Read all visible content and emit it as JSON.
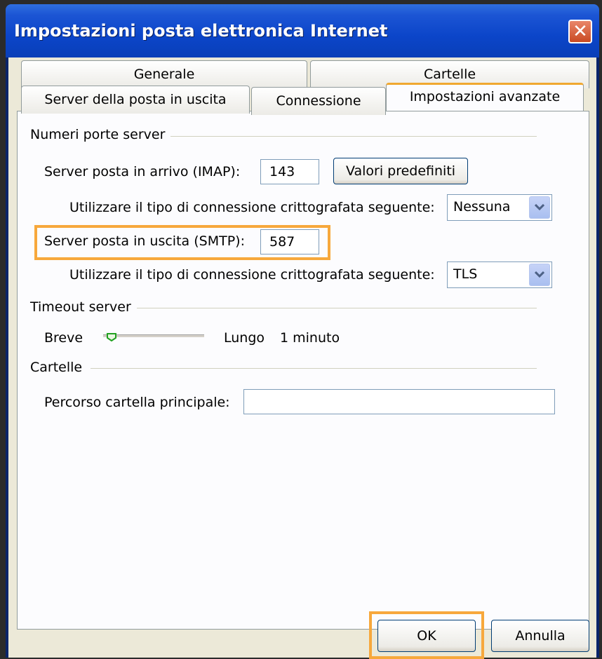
{
  "window": {
    "title": "Impostazioni posta elettronica Internet",
    "close_glyph": "✕"
  },
  "tabs": {
    "row1": [
      "Generale",
      "Cartelle"
    ],
    "row2": [
      "Server della posta in uscita",
      "Connessione",
      "Impostazioni avanzate"
    ],
    "active": "Impostazioni avanzate"
  },
  "ports": {
    "group_label": "Numeri porte server",
    "incoming_label": "Server posta in arrivo (IMAP):",
    "incoming_value": "143",
    "defaults_button": "Valori predefiniti",
    "incoming_encryption_label": "Utilizzare il tipo di connessione crittografata seguente:",
    "incoming_encryption_value": "Nessuna",
    "outgoing_label": "Server posta in uscita (SMTP):",
    "outgoing_value": "587",
    "outgoing_encryption_label": "Utilizzare il tipo di connessione crittografata seguente:",
    "outgoing_encryption_value": "TLS"
  },
  "timeout": {
    "group_label": "Timeout server",
    "short_label": "Breve",
    "long_label": "Lungo",
    "value_label": "1 minuto",
    "slider_level": 0.08
  },
  "folders": {
    "group_label": "Cartelle",
    "root_path_label": "Percorso cartella principale:",
    "root_path_value": ""
  },
  "footer": {
    "ok_label": "OK",
    "cancel_label": "Annulla"
  },
  "colors": {
    "highlight": "#f7a83c",
    "titlebar": "#0b45c9",
    "active_tab_accent": "#f0a830"
  }
}
